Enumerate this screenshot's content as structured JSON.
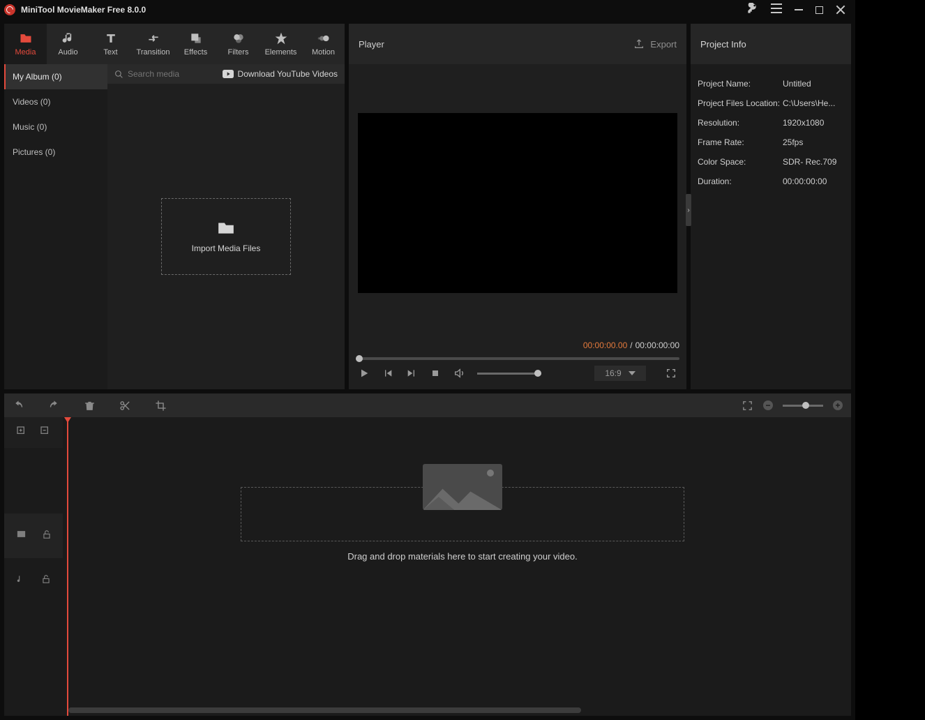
{
  "app": {
    "title": "MiniTool MovieMaker Free 8.0.0"
  },
  "tabs": {
    "media": "Media",
    "audio": "Audio",
    "text": "Text",
    "transition": "Transition",
    "effects": "Effects",
    "filters": "Filters",
    "elements": "Elements",
    "motion": "Motion"
  },
  "sidebar": {
    "my_album": "My Album (0)",
    "videos": "Videos (0)",
    "music": "Music (0)",
    "pictures": "Pictures (0)"
  },
  "media": {
    "search_placeholder": "Search media",
    "download_yt": "Download YouTube Videos",
    "import": "Import Media Files"
  },
  "player": {
    "title": "Player",
    "export": "Export",
    "time_current": "00:00:00.00",
    "time_total": "00:00:00:00",
    "aspect": "16:9"
  },
  "project": {
    "title": "Project Info",
    "labels": {
      "name": "Project Name:",
      "loc": "Project Files Location:",
      "res": "Resolution:",
      "fps": "Frame Rate:",
      "color": "Color Space:",
      "dur": "Duration:"
    },
    "values": {
      "name": "Untitled",
      "loc": "C:\\Users\\He...",
      "res": "1920x1080",
      "fps": "25fps",
      "color": "SDR- Rec.709",
      "dur": "00:00:00:00"
    }
  },
  "timeline": {
    "drop_hint": "Drag and drop materials here to start creating your video."
  }
}
